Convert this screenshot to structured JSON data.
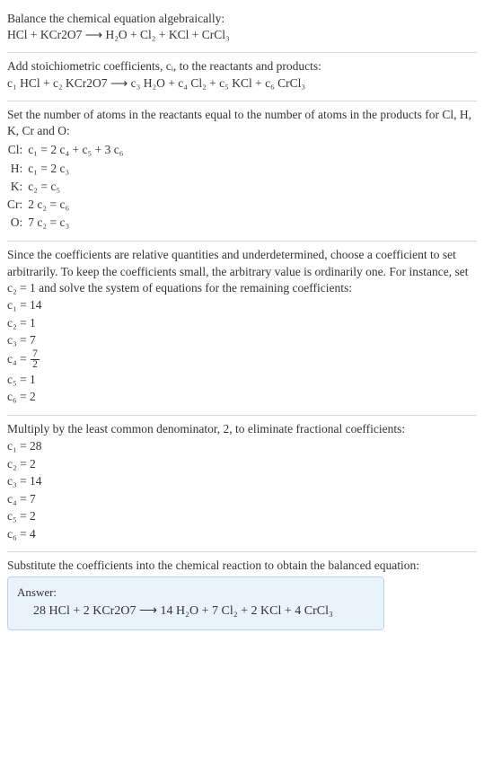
{
  "sec1": {
    "line1": "Balance the chemical equation algebraically:",
    "line2": "HCl + KCr2O7 ⟶ H₂O + Cl₂ + KCl + CrCl₃"
  },
  "sec2": {
    "line1": "Add stoichiometric coefficients, cᵢ, to the reactants and products:",
    "line2": "c₁ HCl + c₂ KCr2O7 ⟶ c₃ H₂O + c₄ Cl₂ + c₅ KCl + c₆ CrCl₃"
  },
  "sec3": {
    "intro": "Set the number of atoms in the reactants equal to the number of atoms in the products for Cl, H, K, Cr and O:",
    "rows": [
      {
        "el": "Cl:",
        "eq": "c₁ = 2 c₄ + c₅ + 3 c₆"
      },
      {
        "el": "H:",
        "eq": "c₁ = 2 c₃"
      },
      {
        "el": "K:",
        "eq": "c₂ = c₅"
      },
      {
        "el": "Cr:",
        "eq": "2 c₂ = c₆"
      },
      {
        "el": "O:",
        "eq": "7 c₂ = c₃"
      }
    ]
  },
  "sec4": {
    "intro": "Since the coefficients are relative quantities and underdetermined, choose a coefficient to set arbitrarily. To keep the coefficients small, the arbitrary value is ordinarily one. For instance, set c₂ = 1 and solve the system of equations for the remaining coefficients:",
    "coefs": {
      "c1": "c₁ = 14",
      "c2": "c₂ = 1",
      "c3": "c₃ = 7",
      "c4_pre": "c₄ = ",
      "c4_num": "7",
      "c4_den": "2",
      "c5": "c₅ = 1",
      "c6": "c₆ = 2"
    }
  },
  "sec5": {
    "intro": "Multiply by the least common denominator, 2, to eliminate fractional coefficients:",
    "coefs": [
      "c₁ = 28",
      "c₂ = 2",
      "c₃ = 14",
      "c₄ = 7",
      "c₅ = 2",
      "c₆ = 4"
    ]
  },
  "sec6": {
    "intro": "Substitute the coefficients into the chemical reaction to obtain the balanced equation:",
    "answer_label": "Answer:",
    "answer": "28 HCl + 2 KCr2O7 ⟶ 14 H₂O + 7 Cl₂ + 2 KCl + 4 CrCl₃"
  }
}
